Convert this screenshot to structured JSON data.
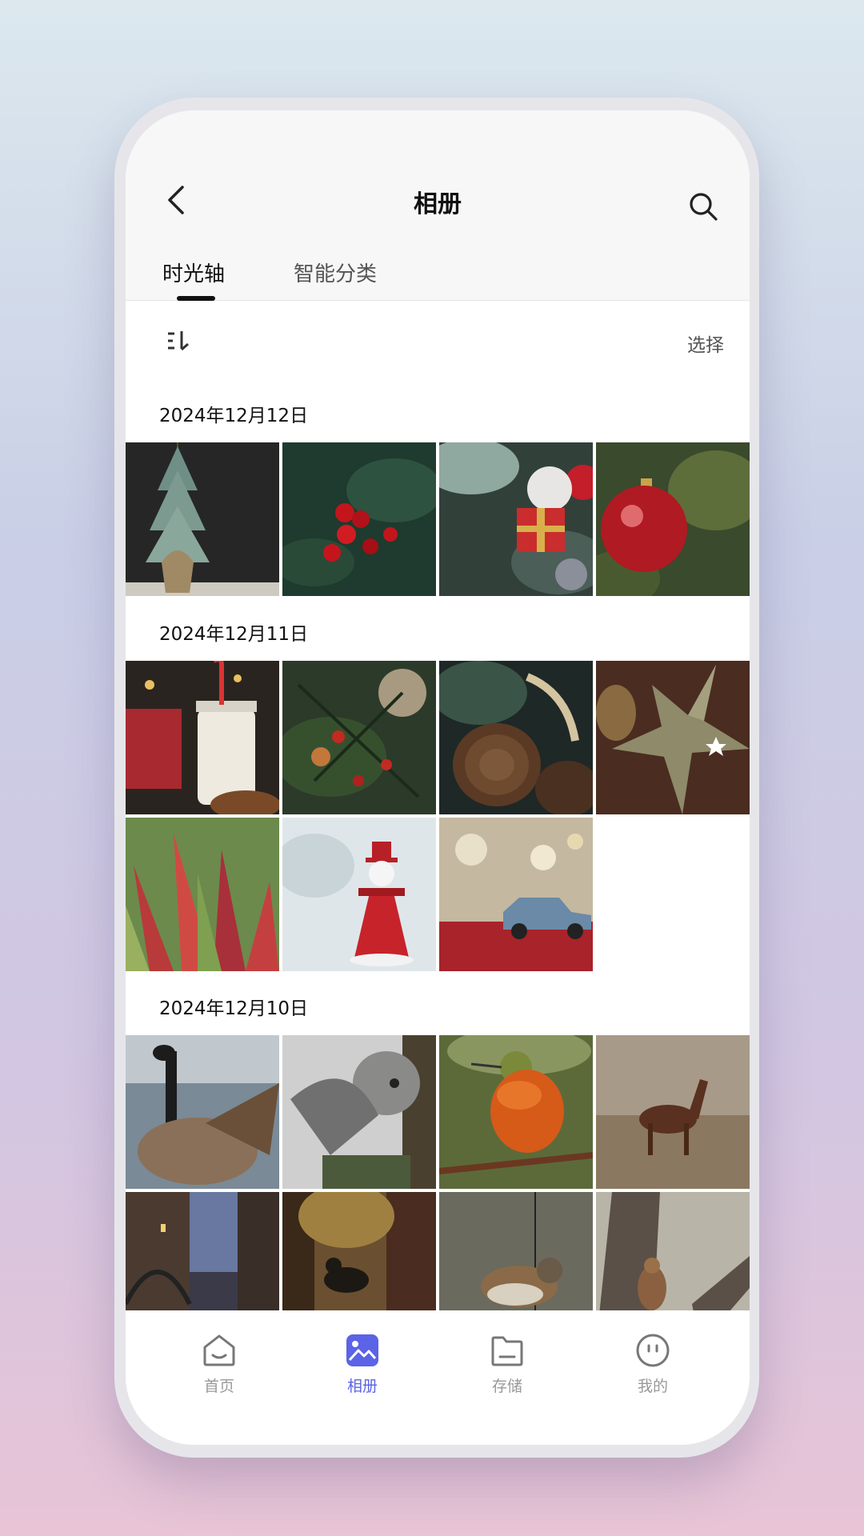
{
  "header": {
    "title": "相册"
  },
  "tabs": [
    {
      "label": "时光轴",
      "active": true
    },
    {
      "label": "智能分类",
      "active": false
    }
  ],
  "toolbar": {
    "sort_icon": "sort-icon",
    "select_label": "选择"
  },
  "sections": [
    {
      "date": "2024年12月12日",
      "photos": [
        "small-christmas-tree",
        "holly-berries",
        "gift-box-ornament",
        "red-bauble"
      ]
    },
    {
      "date": "2024年12月11日",
      "photos": [
        "milk-candy-cane",
        "pine-berries",
        "pine-cone",
        "wooden-star",
        "red-succulent",
        "snowman-figurine",
        "toy-car-gift"
      ]
    },
    {
      "date": "2024年12月10日",
      "photos": [
        "goose",
        "owl",
        "hummingbird",
        "horse",
        "bridge-night",
        "dog-forest",
        "sparrow",
        "squirrel"
      ]
    }
  ],
  "bottom_nav": [
    {
      "label": "首页",
      "icon": "home-icon",
      "active": false
    },
    {
      "label": "相册",
      "icon": "gallery-icon",
      "active": true
    },
    {
      "label": "存储",
      "icon": "folder-icon",
      "active": false
    },
    {
      "label": "我的",
      "icon": "profile-icon",
      "active": false
    }
  ],
  "colors": {
    "accent": "#5b63e6",
    "text": "#111111",
    "muted": "#999999"
  }
}
